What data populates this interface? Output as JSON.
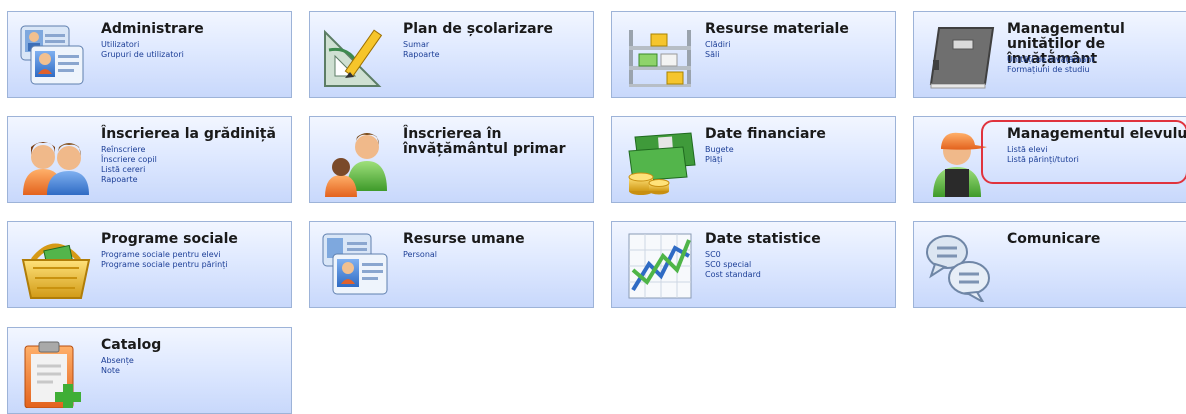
{
  "tiles": [
    {
      "title": "Administrare",
      "icon": "user-cards-icon",
      "links": [
        "Utilizatori",
        "Grupuri de utilizatori"
      ]
    },
    {
      "title": "Plan de școlarizare",
      "icon": "set-square-pencil-icon",
      "links": [
        "Sumar",
        "Rapoarte"
      ]
    },
    {
      "title": "Resurse materiale",
      "icon": "shelves-icon",
      "links": [
        "Clădiri",
        "Săli"
      ]
    },
    {
      "title": "Managementul unităților de învățământ",
      "icon": "book-icon",
      "links": [
        "Unități de învățământ",
        "Formațiuni de studiu"
      ]
    },
    {
      "title": "Înscrierea la grădiniță",
      "icon": "parents-icon",
      "links": [
        "Reînscriere",
        "Înscriere copil",
        "Listă cereri",
        "Rapoarte"
      ]
    },
    {
      "title": "Înscrierea în învățământul primar",
      "icon": "parent-child-icon",
      "links": []
    },
    {
      "title": "Date financiare",
      "icon": "money-coins-icon",
      "links": [
        "Bugete",
        "Plăți"
      ]
    },
    {
      "title": "Managementul elevului",
      "icon": "student-cap-icon",
      "links": [
        "Listă elevi",
        "Listă părinți/tutori"
      ]
    },
    {
      "title": "Programe sociale",
      "icon": "basket-icon",
      "links": [
        "Programe sociale pentru elevi",
        "Programe sociale pentru părinți"
      ]
    },
    {
      "title": "Resurse umane",
      "icon": "id-cards-icon",
      "links": [
        "Personal"
      ]
    },
    {
      "title": "Date statistice",
      "icon": "line-chart-icon",
      "links": [
        "SC0",
        "SC0 special",
        "Cost standard"
      ]
    },
    {
      "title": "Comunicare",
      "icon": "speech-bubbles-icon",
      "links": []
    },
    {
      "title": "Catalog",
      "icon": "clipboard-add-icon",
      "links": [
        "Absențe",
        "Note"
      ]
    }
  ]
}
